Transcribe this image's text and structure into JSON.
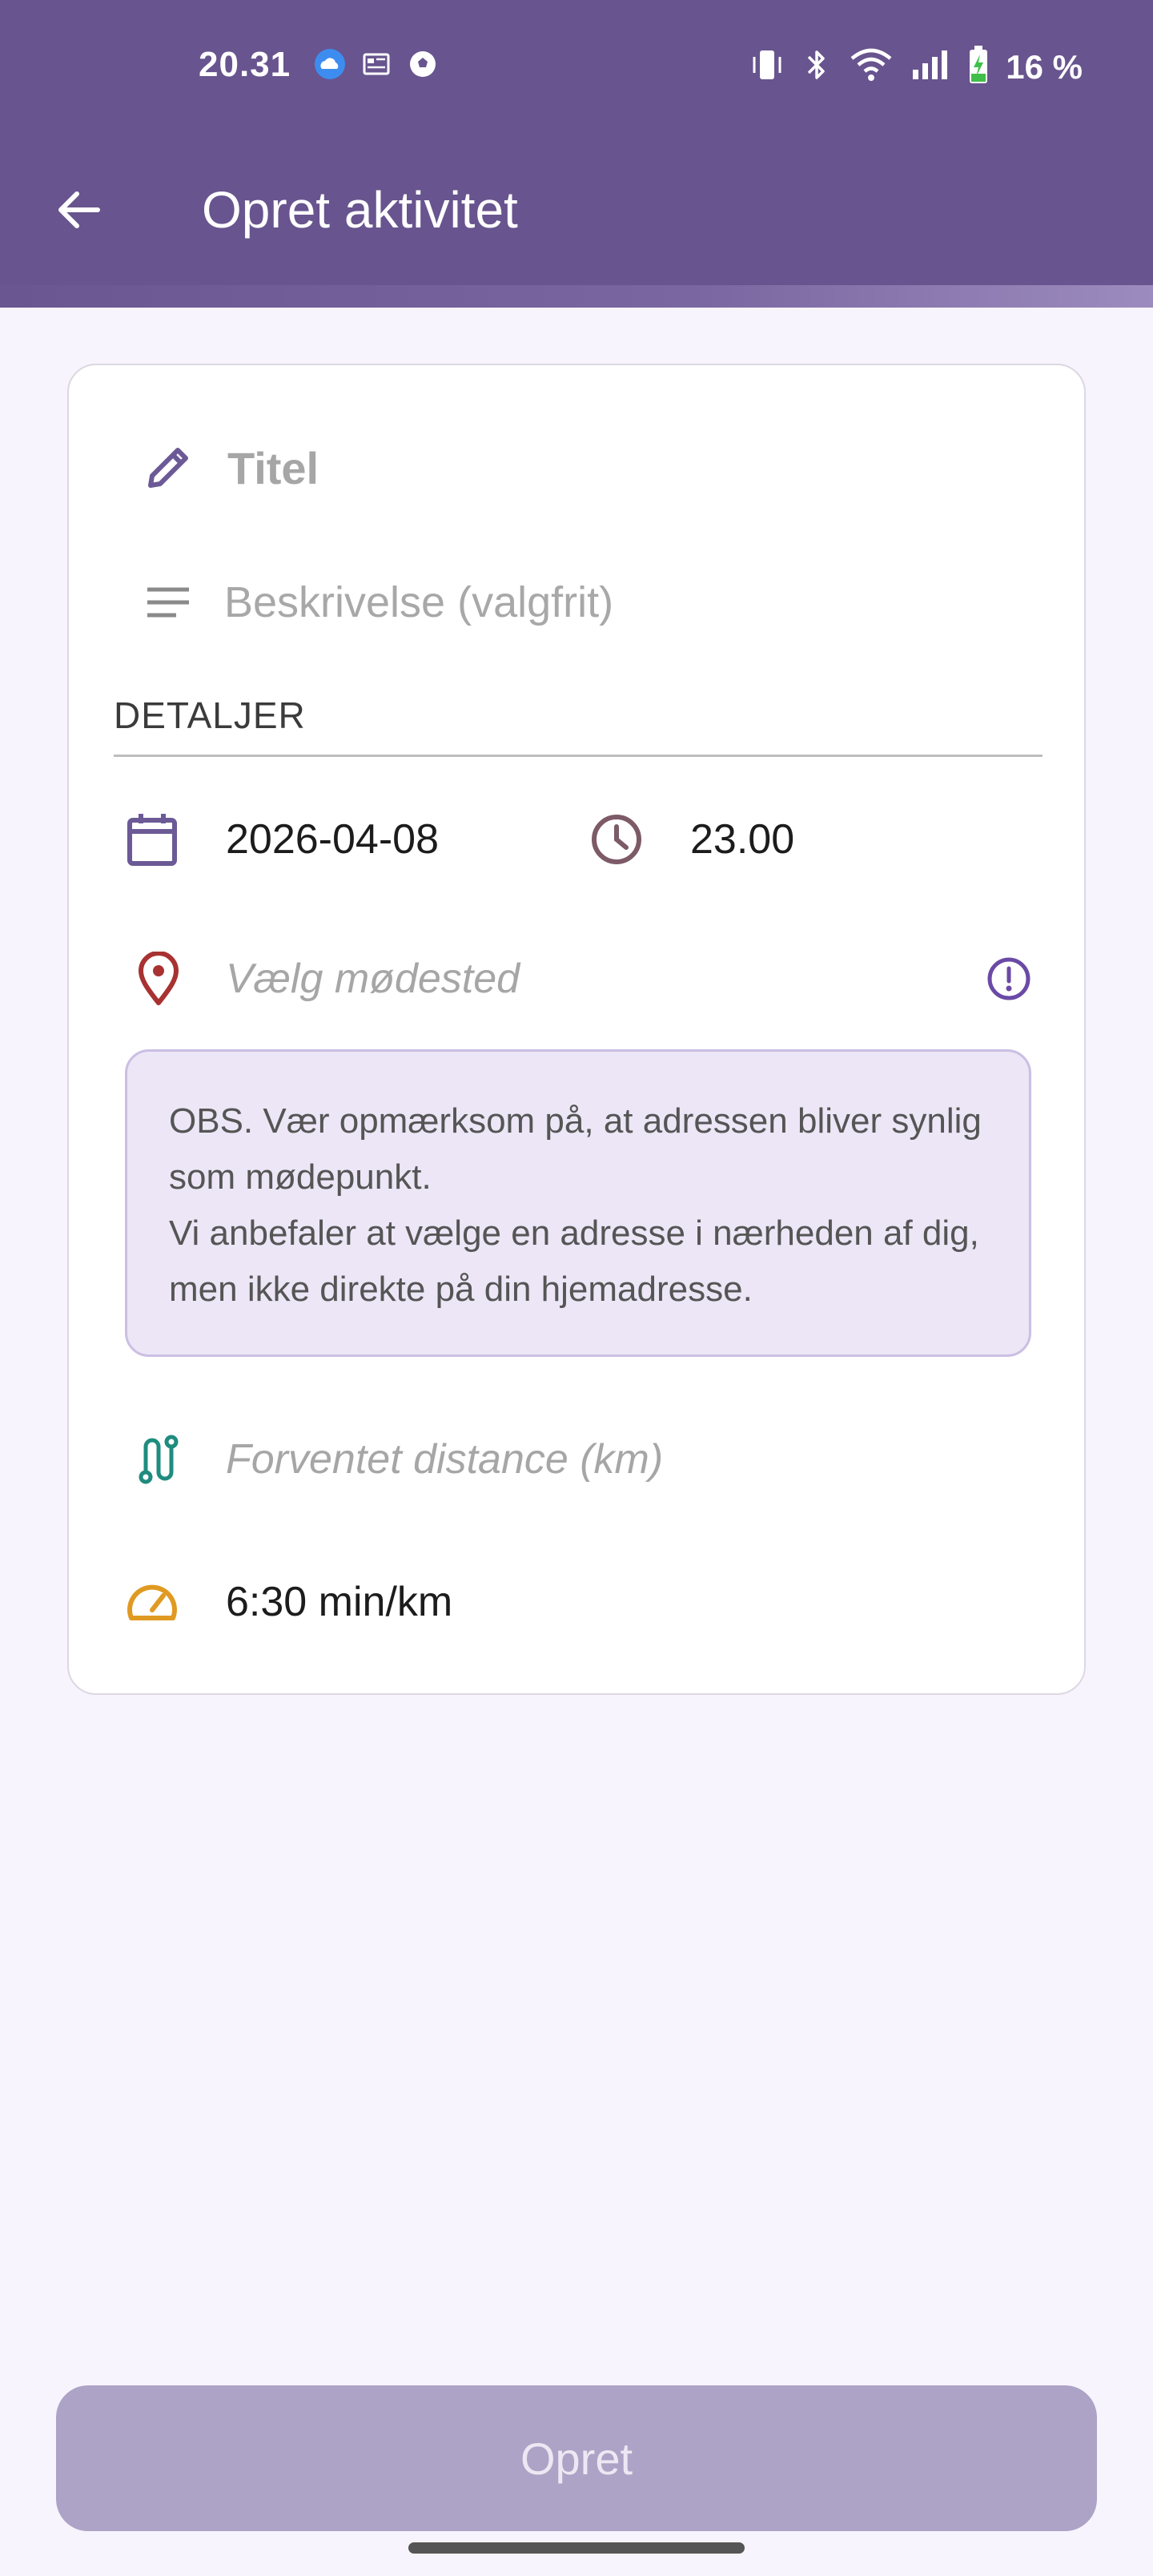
{
  "status_bar": {
    "time": "20.31",
    "battery_text": "16 %",
    "left_icons": [
      "weather-icon",
      "news-icon",
      "soccer-icon"
    ],
    "right_icons": [
      "vibrate-icon",
      "bluetooth-icon",
      "wifi-icon",
      "signal-icon",
      "battery-charging-icon"
    ]
  },
  "header": {
    "title": "Opret aktivitet",
    "back_icon": "arrow-back-icon",
    "color": "#68548e"
  },
  "form": {
    "title_placeholder": "Titel",
    "description_placeholder": "Beskrivelse (valgfrit)",
    "section_label": "DETALJER",
    "date_value": "2026-04-08",
    "time_value": "23.00",
    "location_placeholder": "Vælg mødested",
    "notice_line1": "OBS. Vær opmærksom på, at adressen bliver synlig som mødepunkt.",
    "notice_line2": "Vi anbefaler at vælge en adresse i nærheden af dig, men ikke direkte på din hjemadresse.",
    "distance_placeholder": "Forventet distance (km)",
    "pace_value": "6:30 min/km",
    "icons": {
      "title": "pencil-icon",
      "description": "notes-icon",
      "date": "calendar-icon",
      "time": "clock-icon",
      "location": "location-pin-icon",
      "info": "info-alert-icon",
      "distance": "route-icon",
      "pace": "speedometer-icon"
    },
    "icon_colors": {
      "pencil": "#6b5a96",
      "calendar": "#6b5a96",
      "clock": "#7d5a67",
      "pin": "#a83232",
      "info": "#6b4aa6",
      "route": "#1e8c7e",
      "speed": "#e09a22"
    }
  },
  "footer": {
    "submit_label": "Opret",
    "submit_color": "#ada3c6"
  }
}
